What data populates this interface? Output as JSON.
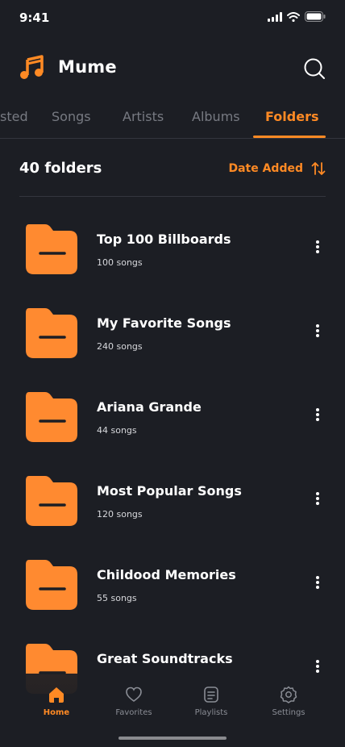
{
  "status_bar": {
    "time": "9:41"
  },
  "app": {
    "title": "Mume"
  },
  "tabs": [
    {
      "label": "sted"
    },
    {
      "label": "Songs"
    },
    {
      "label": "Artists"
    },
    {
      "label": "Albums"
    },
    {
      "label": "Folders",
      "active": true
    }
  ],
  "list_header": {
    "count": "40 folders",
    "sort_label": "Date Added"
  },
  "folders": [
    {
      "title": "Top 100 Billboards",
      "subtitle": "100 songs"
    },
    {
      "title": "My Favorite Songs",
      "subtitle": "240 songs"
    },
    {
      "title": "Ariana Grande",
      "subtitle": "44 songs"
    },
    {
      "title": "Most Popular Songs",
      "subtitle": "120 songs"
    },
    {
      "title": "Childood Memories",
      "subtitle": "55 songs"
    },
    {
      "title": "Great Soundtracks",
      "subtitle": ""
    }
  ],
  "bottom_nav": [
    {
      "label": "Home",
      "icon": "home-icon",
      "active": true
    },
    {
      "label": "Favorites",
      "icon": "heart-icon"
    },
    {
      "label": "Playlists",
      "icon": "document-icon"
    },
    {
      "label": "Settings",
      "icon": "gear-icon"
    }
  ],
  "colors": {
    "accent": "#ff8a24",
    "background": "#1c1e24",
    "muted": "#777a82"
  }
}
